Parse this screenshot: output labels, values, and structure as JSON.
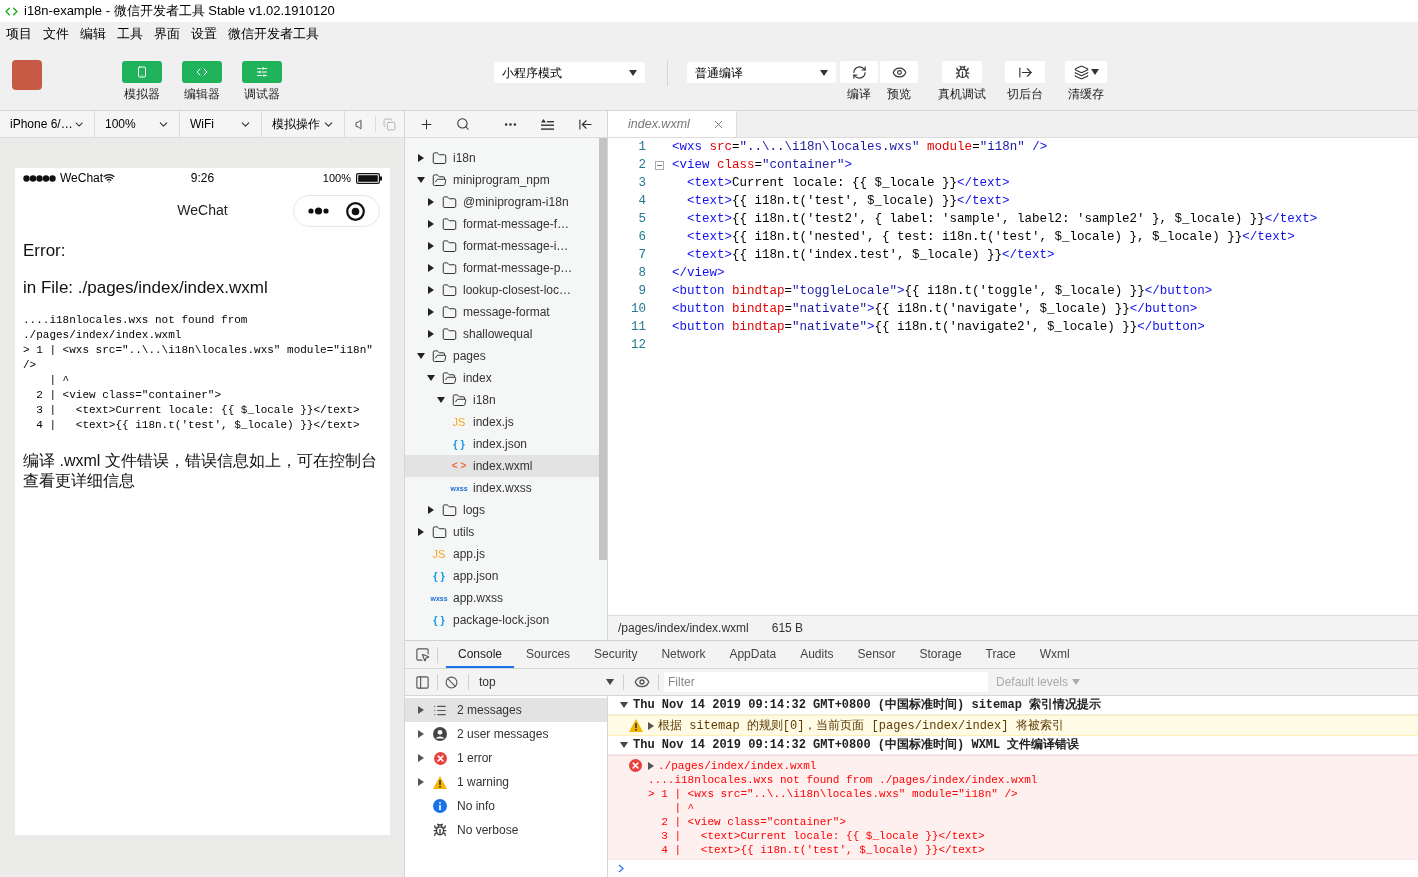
{
  "window": {
    "title": "i18n-example - 微信开发者工具 Stable v1.02.1910120"
  },
  "menu": [
    "项目",
    "文件",
    "编辑",
    "工具",
    "界面",
    "设置",
    "微信开发者工具"
  ],
  "toolbar": {
    "panels": [
      {
        "label": "模拟器",
        "on": true
      },
      {
        "label": "编辑器",
        "on": true
      },
      {
        "label": "调试器",
        "on": true
      }
    ],
    "mode_select": "小程序模式",
    "compile_select": "普通编译",
    "actions": [
      {
        "label": "编译"
      },
      {
        "label": "预览"
      },
      {
        "label": "真机调试"
      },
      {
        "label": "切后台"
      },
      {
        "label": "清缓存"
      }
    ]
  },
  "simulator": {
    "selects": [
      "iPhone 6/…",
      "100%",
      "WiFi",
      "模拟操作"
    ],
    "status_bar": {
      "carrier": "WeChat",
      "time": "9:26",
      "battery": "100%"
    },
    "nav_title": "WeChat",
    "error_title": "Error:",
    "file_line": "in File: ./pages/index/index.wxml",
    "code_lines": [
      "....i18nlocales.wxs not found from ./pages/index/index.wxml",
      "> 1 | <wxs src=\"..\\..\\i18n\\locales.wxs\" module=\"i18n\" />",
      "    | ^",
      "  2 | <view class=\"container\">",
      "  3 |   <text>Current locale: {{ $_locale }}</text>",
      "  4 |   <text>{{ i18n.t('test', $_locale) }}</text>"
    ],
    "message": "编译 .wxml 文件错误，错误信息如上，可在控制台查看更详细信息"
  },
  "file_tree": {
    "items": [
      {
        "name": "i18n",
        "kind": "folder",
        "expanded": false,
        "selected": false
      },
      {
        "name": "miniprogram_npm",
        "kind": "folder",
        "expanded": true,
        "selected": false,
        "children": [
          {
            "name": "@miniprogram-i18n",
            "kind": "folder",
            "expanded": false,
            "selected": false
          },
          {
            "name": "format-message-f…",
            "kind": "folder",
            "expanded": false,
            "selected": false
          },
          {
            "name": "format-message-i…",
            "kind": "folder",
            "expanded": false,
            "selected": false
          },
          {
            "name": "format-message-p…",
            "kind": "folder",
            "expanded": false,
            "selected": false
          },
          {
            "name": "lookup-closest-loc…",
            "kind": "folder",
            "expanded": false,
            "selected": false
          },
          {
            "name": "message-format",
            "kind": "folder",
            "expanded": false,
            "selected": false
          },
          {
            "name": "shallowequal",
            "kind": "folder",
            "expanded": false,
            "selected": false
          }
        ]
      },
      {
        "name": "pages",
        "kind": "folder",
        "expanded": true,
        "selected": false,
        "children": [
          {
            "name": "index",
            "kind": "folder",
            "expanded": true,
            "selected": false,
            "children": [
              {
                "name": "i18n",
                "kind": "folder",
                "expanded": true,
                "selected": false
              },
              {
                "name": "index.js",
                "kind": "js",
                "icon_label": "JS",
                "selected": false
              },
              {
                "name": "index.json",
                "kind": "json",
                "icon_label": "{ }",
                "selected": false
              },
              {
                "name": "index.wxml",
                "kind": "wxml",
                "icon_label": "< >",
                "selected": true
              },
              {
                "name": "index.wxss",
                "kind": "wxss",
                "icon_label": "wxss",
                "selected": false
              }
            ]
          },
          {
            "name": "logs",
            "kind": "folder",
            "expanded": false,
            "selected": false
          }
        ]
      },
      {
        "name": "utils",
        "kind": "folder",
        "expanded": false,
        "selected": false
      },
      {
        "name": "app.js",
        "kind": "js",
        "icon_label": "JS",
        "selected": false
      },
      {
        "name": "app.json",
        "kind": "json",
        "icon_label": "{ }",
        "selected": false
      },
      {
        "name": "app.wxss",
        "kind": "wxss",
        "icon_label": "wxss",
        "selected": false
      },
      {
        "name": "package-lock.json",
        "kind": "json",
        "icon_label": "{ }",
        "selected": false
      }
    ]
  },
  "editor": {
    "tabs": [
      {
        "label": "index.wxml",
        "selected": true
      }
    ],
    "lines": [
      {
        "number": "1",
        "collapsible": false,
        "text": "<wxs src=\"..\\..\\i18n\\locales.wxs\" module=\"i18n\" />"
      },
      {
        "number": "2",
        "collapsible": true,
        "text": "<view class=\"container\">"
      },
      {
        "number": "3",
        "collapsible": false,
        "text": "  <text>Current locale: {{ $_locale }}</text>"
      },
      {
        "number": "4",
        "collapsible": false,
        "text": "  <text>{{ i18n.t('test', $_locale) }}</text>"
      },
      {
        "number": "5",
        "collapsible": false,
        "text": "  <text>{{ i18n.t('test2', { label: 'sample', label2: 'sample2' }, $_locale) }}</text>"
      },
      {
        "number": "6",
        "collapsible": false,
        "text": "  <text>{{ i18n.t('nested', { test: i18n.t('test', $_locale) }, $_locale) }}</text>"
      },
      {
        "number": "7",
        "collapsible": false,
        "text": "  <text>{{ i18n.t('index.test', $_locale) }}</text>"
      },
      {
        "number": "8",
        "collapsible": false,
        "text": "</view>"
      },
      {
        "number": "9",
        "collapsible": false,
        "text": "<button bindtap=\"toggleLocale\">{{ i18n.t('toggle', $_locale) }}</button>"
      },
      {
        "number": "10",
        "collapsible": false,
        "text": "<button bindtap=\"nativate\">{{ i18n.t('navigate', $_locale) }}</button>"
      },
      {
        "number": "11",
        "collapsible": false,
        "text": "<button bindtap=\"nativate\">{{ i18n.t('navigate2', $_locale) }}</button>"
      },
      {
        "number": "12",
        "collapsible": false
      }
    ],
    "status": {
      "path": "/pages/index/index.wxml",
      "size": "615 B"
    }
  },
  "devtools": {
    "tabs": [
      {
        "label": "Console",
        "selected": true
      },
      {
        "label": "Sources",
        "selected": false
      },
      {
        "label": "Security",
        "selected": false
      },
      {
        "label": "Network",
        "selected": false
      },
      {
        "label": "AppData",
        "selected": false
      },
      {
        "label": "Audits",
        "selected": false
      },
      {
        "label": "Sensor",
        "selected": false
      },
      {
        "label": "Storage",
        "selected": false
      },
      {
        "label": "Trace",
        "selected": false
      },
      {
        "label": "Wxml",
        "selected": false
      }
    ],
    "context": "top",
    "filter": {
      "placeholder": "Filter"
    },
    "levels": "Default levels",
    "sidebar": [
      {
        "kind": "messages",
        "label": "2 messages",
        "expandable": true,
        "selected": true
      },
      {
        "kind": "user",
        "label": "2 user messages",
        "expandable": true,
        "selected": false
      },
      {
        "kind": "error",
        "label": "1 error",
        "expandable": true,
        "selected": false
      },
      {
        "kind": "warning",
        "label": "1 warning",
        "expandable": true,
        "selected": false
      },
      {
        "kind": "info",
        "label": "No info",
        "expandable": false,
        "selected": false
      },
      {
        "kind": "verbose",
        "label": "No verbose",
        "expandable": false,
        "selected": false
      }
    ],
    "console": {
      "groups": [
        {
          "title": "Thu Nov 14 2019 09:14:32 GMT+0800 (中国标准时间) sitemap 索引情况提示",
          "expanded": true,
          "messages": [
            {
              "kind": "warning",
              "expanded": false,
              "text": "根据 sitemap 的规则[0]，当前页面 [pages/index/index] 将被索引"
            }
          ]
        },
        {
          "title": "Thu Nov 14 2019 09:14:32 GMT+0800 (中国标准时间) WXML 文件编译错误",
          "expanded": true,
          "messages": [
            {
              "kind": "error",
              "expanded": false,
              "text": "./pages/index/index.wxml",
              "details": [
                "....i18nlocales.wxs not found from ./pages/index/index.wxml",
                "> 1 | <wxs src=\"..\\..\\i18n\\locales.wxs\" module=\"i18n\" />",
                "    | ^",
                "  2 | <view class=\"container\">",
                "  3 |   <text>Current locale: {{ $_locale }}</text>",
                "  4 |   <text>{{ i18n.t('test', $_locale) }}</text>"
              ]
            }
          ]
        }
      ]
    }
  }
}
